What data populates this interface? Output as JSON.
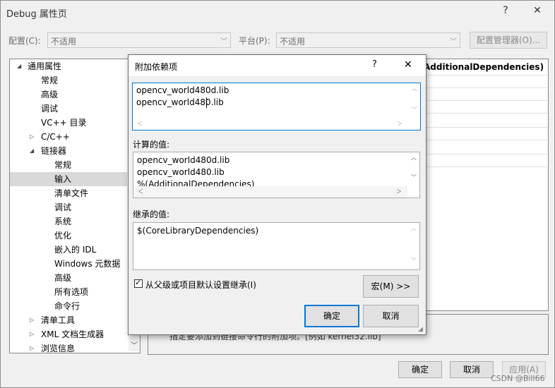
{
  "window": {
    "title": "Debug 属性页",
    "help": "?",
    "close": "✕"
  },
  "toolbar": {
    "config_label": "配置(C):",
    "config_value": "不适用",
    "platform_label": "平台(P):",
    "platform_value": "不适用",
    "config_manager_label": "配置管理器(O)..."
  },
  "tree": {
    "items": [
      {
        "label": "通用属性",
        "twist": "◢"
      },
      {
        "label": "常规"
      },
      {
        "label": "高级"
      },
      {
        "label": "调试"
      },
      {
        "label": "VC++ 目录"
      },
      {
        "label": "C/C++",
        "twist": "▷"
      },
      {
        "label": "链接器",
        "twist": "◢"
      },
      {
        "label": "常规"
      },
      {
        "label": "输入"
      },
      {
        "label": "清单文件"
      },
      {
        "label": "调试"
      },
      {
        "label": "系统"
      },
      {
        "label": "优化"
      },
      {
        "label": "嵌入的 IDL"
      },
      {
        "label": "Windows 元数据"
      },
      {
        "label": "高级"
      },
      {
        "label": "所有选项"
      },
      {
        "label": "命令行"
      },
      {
        "label": "清单工具",
        "twist": "▷"
      },
      {
        "label": "XML 文档生成器",
        "twist": "▷"
      },
      {
        "label": "浏览信息",
        "twist": "▷"
      }
    ]
  },
  "grid": {
    "visible_header": "AdditionalDependencies)"
  },
  "description": {
    "text": "指定要添加到链接命令行的附加项。[例如 kernel32.lib]"
  },
  "dialog": {
    "title": "附加依赖项",
    "help": "?",
    "close": "✕",
    "input_lines": [
      "opencv_world480d.lib",
      "opencv_world480.lib"
    ],
    "computed_label": "计算的值:",
    "computed_lines": [
      "opencv_world480d.lib",
      "opencv_world480.lib",
      "%(AdditionalDependencies)"
    ],
    "inherited_label": "继承的值:",
    "inherited_lines": [
      "$(CoreLibraryDependencies)"
    ],
    "inherit_checkbox_label": "从父级或项目默认设置继承(I)",
    "inherit_checked": true,
    "macro_button": "宏(M) >>",
    "ok_button": "确定",
    "cancel_button": "取消"
  },
  "footer": {
    "ok": "确定",
    "cancel": "取消",
    "apply": "应用(A)"
  },
  "watermark": "CSDN @Bill66"
}
